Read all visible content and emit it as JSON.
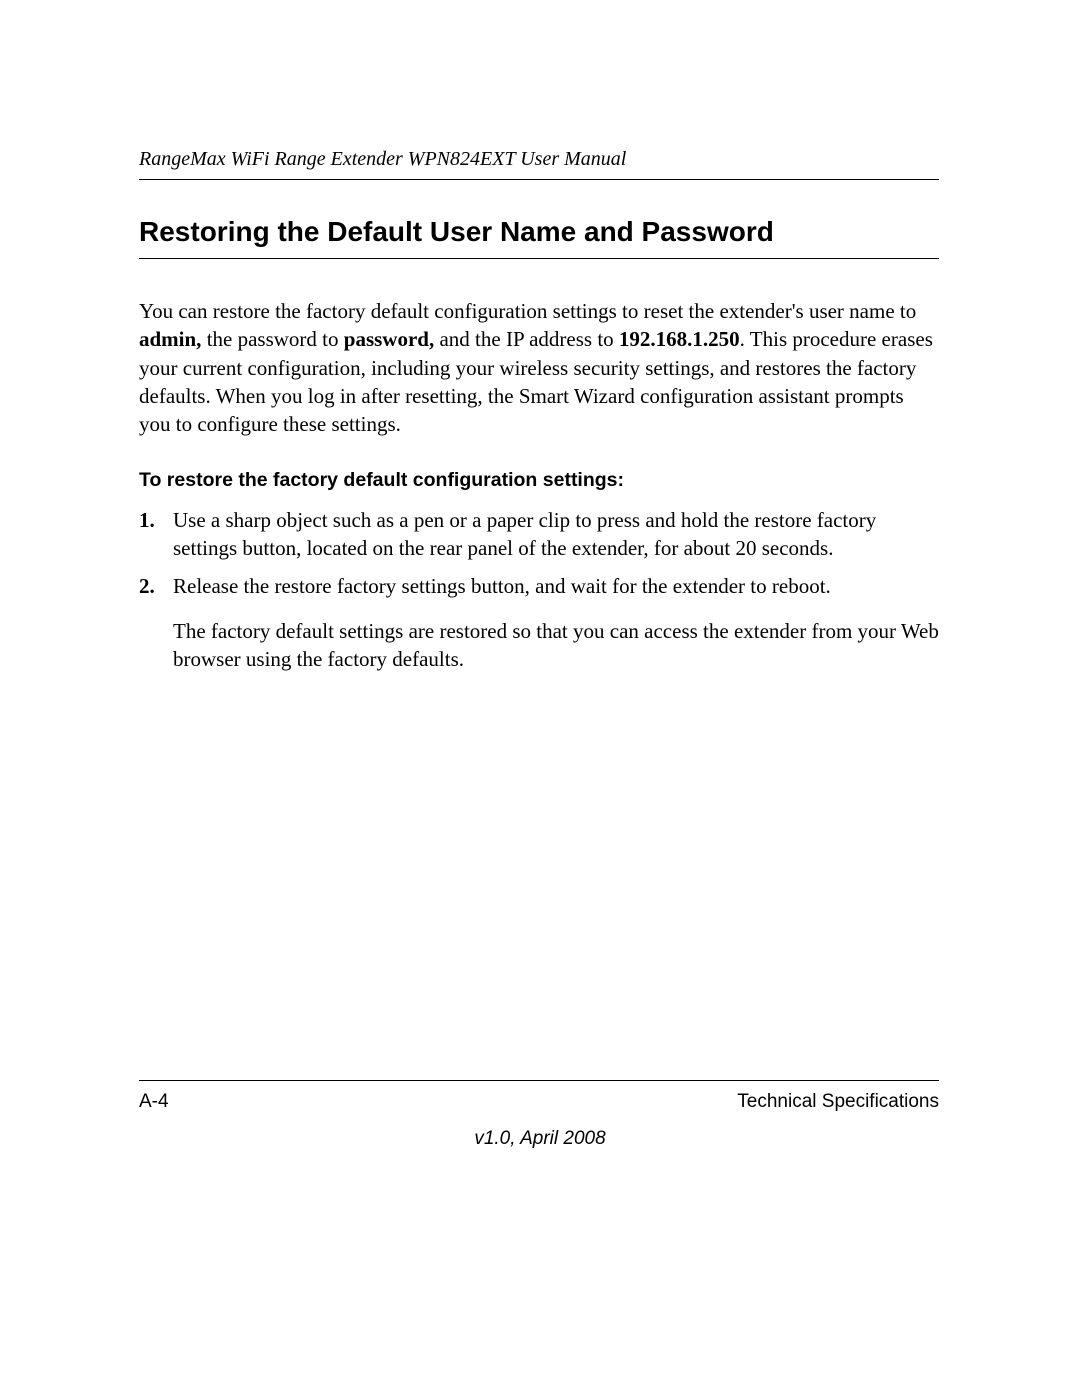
{
  "header": {
    "running_title": "RangeMax WiFi Range Extender WPN824EXT User Manual"
  },
  "section": {
    "heading": "Restoring the Default User Name and Password",
    "intro": {
      "t1": "You can restore the factory default configuration settings to reset the extender's user name to ",
      "b1": "admin,",
      "t2": " the password to ",
      "b2": "password,",
      "t3": " and the IP address to ",
      "b3": "192.168.1.250",
      "t4": ". This procedure erases your current configuration, including your wireless security settings, and restores the factory defaults. When you log in after resetting, the Smart Wizard configuration assistant prompts you to configure these settings."
    },
    "sub_heading": "To restore the factory default configuration settings:",
    "steps": [
      {
        "num": "1.",
        "text": "Use a sharp object such as a pen or a paper clip to press and hold the restore factory settings button, located on the rear panel of the extender, for about 20 seconds."
      },
      {
        "num": "2.",
        "text": "Release the restore factory settings button, and wait for the extender to reboot."
      }
    ],
    "step2_followup": "The factory default settings are restored so that you can access the extender from your Web browser using the factory defaults."
  },
  "footer": {
    "page_num": "A-4",
    "section_name": "Technical Specifications",
    "version": "v1.0, April 2008"
  }
}
